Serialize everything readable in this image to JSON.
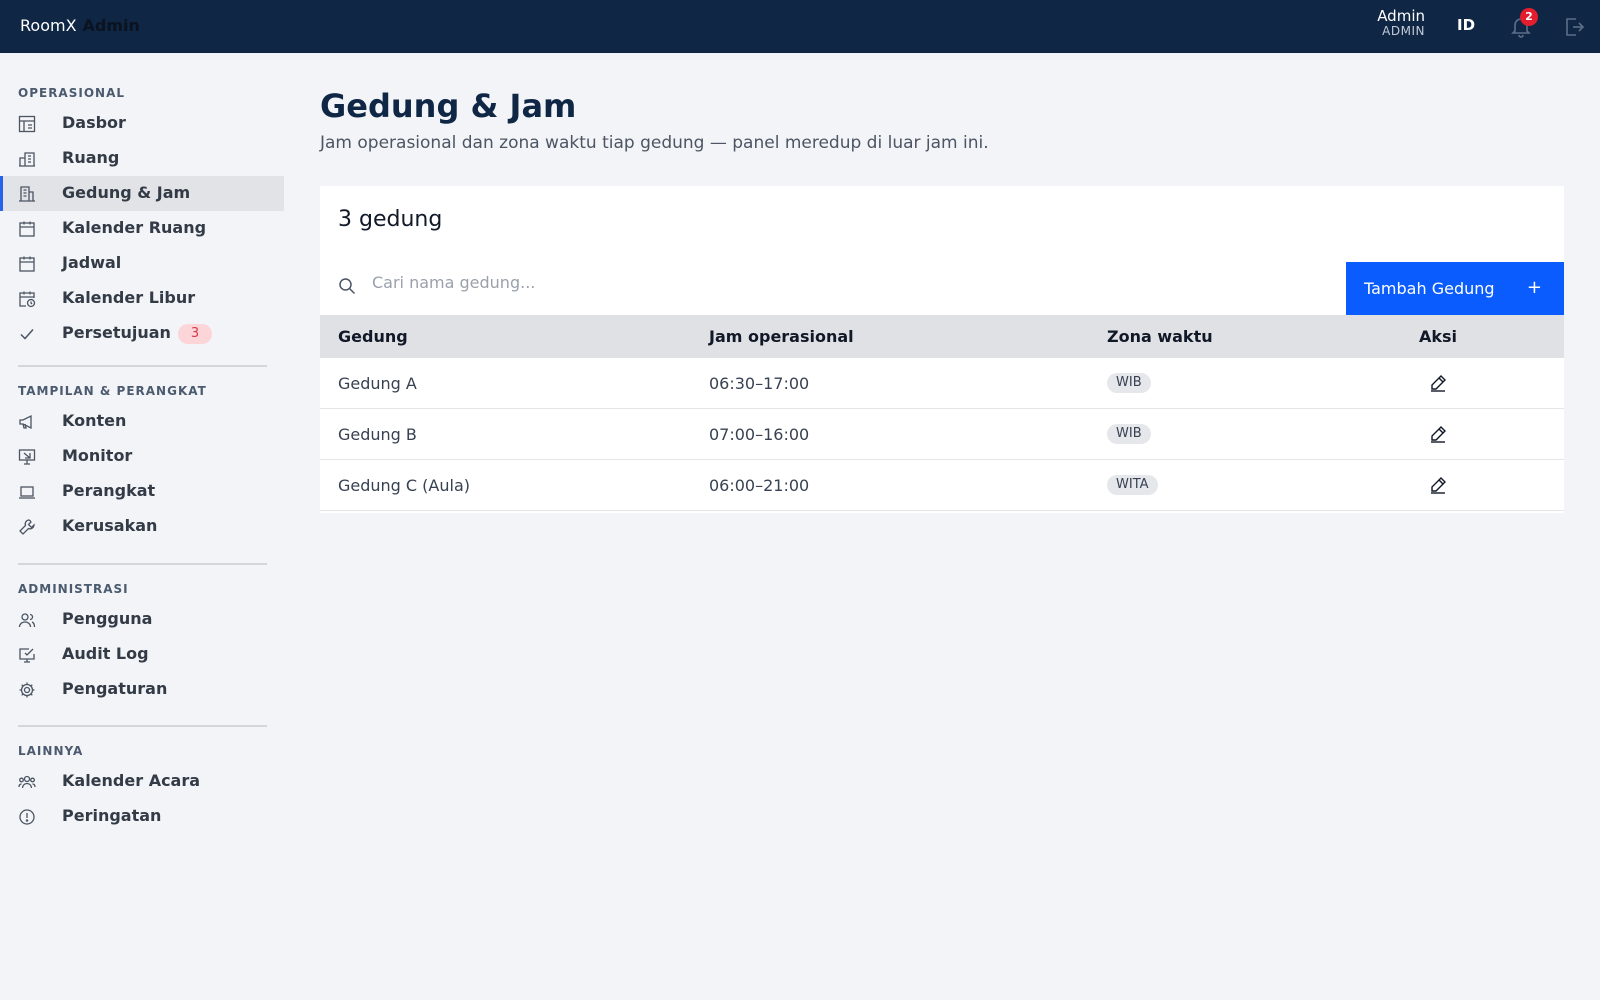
{
  "topbar": {
    "brand_app": "RoomX",
    "brand_sub": "Admin",
    "user_name": "Admin",
    "user_role": "ADMIN",
    "lang": "ID",
    "notif_count": "2"
  },
  "sidebar": {
    "sections": [
      {
        "title": "OPERASIONAL"
      },
      {
        "title": "TAMPILAN & PERANGKAT"
      },
      {
        "title": "ADMINISTRASI"
      },
      {
        "title": "LAINNYA"
      }
    ],
    "items": [
      {
        "label": "Dasbor",
        "icon": "dashboard-icon"
      },
      {
        "label": "Ruang",
        "icon": "room-icon"
      },
      {
        "label": "Gedung & Jam",
        "icon": "building-icon",
        "active": true
      },
      {
        "label": "Kalender Ruang",
        "icon": "calendar-icon"
      },
      {
        "label": "Jadwal",
        "icon": "calendar-icon"
      },
      {
        "label": "Kalender Libur",
        "icon": "calendar-clock-icon"
      },
      {
        "label": "Persetujuan",
        "icon": "check-icon",
        "badge": "3"
      },
      {
        "label": "Konten",
        "icon": "megaphone-icon"
      },
      {
        "label": "Monitor",
        "icon": "monitor-icon"
      },
      {
        "label": "Perangkat",
        "icon": "laptop-icon"
      },
      {
        "label": "Kerusakan",
        "icon": "wrench-icon"
      },
      {
        "label": "Pengguna",
        "icon": "users-icon"
      },
      {
        "label": "Audit Log",
        "icon": "audit-icon"
      },
      {
        "label": "Pengaturan",
        "icon": "gear-icon"
      },
      {
        "label": "Kalender Acara",
        "icon": "group-icon"
      },
      {
        "label": "Peringatan",
        "icon": "alert-icon"
      }
    ]
  },
  "main": {
    "title": "Gedung & Jam",
    "subtitle": "Jam operasional dan zona waktu tiap gedung — panel meredup di luar jam ini.",
    "count_label": "3 gedung",
    "search_placeholder": "Cari nama gedung...",
    "add_button": "Tambah Gedung",
    "add_icon": "+",
    "table": {
      "headers": [
        "Gedung",
        "Jam operasional",
        "Zona waktu",
        "Aksi"
      ],
      "rows": [
        {
          "name": "Gedung A",
          "hours": "06:30–17:00",
          "tz": "WIB"
        },
        {
          "name": "Gedung B",
          "hours": "07:00–16:00",
          "tz": "WIB"
        },
        {
          "name": "Gedung C (Aula)",
          "hours": "06:00–21:00",
          "tz": "WITA"
        }
      ]
    }
  },
  "colors": {
    "topbar": "#0f2645",
    "accent": "#0b5cff",
    "badge_red": "#e11d2e"
  }
}
